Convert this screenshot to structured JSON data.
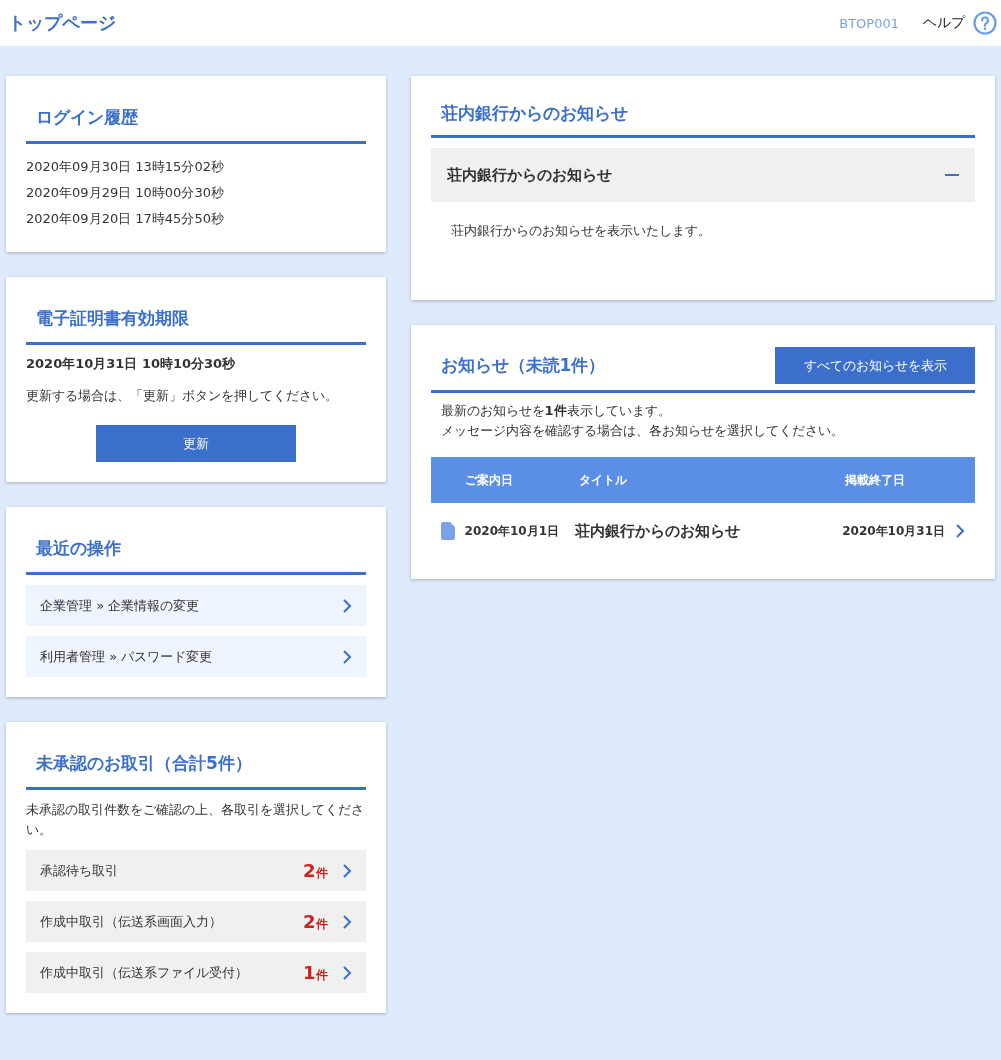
{
  "header": {
    "title": "トップページ",
    "screen_id": "BTOP001",
    "help": "ヘルプ"
  },
  "login_history": {
    "title": "ログイン履歴",
    "entries": [
      "2020年09月30日 13時15分02秒",
      "2020年09月29日 10時00分30秒",
      "2020年09月20日 17時45分50秒"
    ]
  },
  "certificate": {
    "title": "電子証明書有効期限",
    "expiry": "2020年10月31日 10時10分30秒",
    "note": "更新する場合は、「更新」ボタンを押してください。",
    "button": "更新"
  },
  "recent": {
    "title": "最近の操作",
    "items": [
      "企業管理 » 企業情報の変更",
      "利用者管理 » パスワード変更"
    ]
  },
  "pending": {
    "title": "未承認のお取引（合計5件）",
    "note": "未承認の取引件数をご確認の上、各取引を選択してください。",
    "items": [
      {
        "label": "承認待ち取引",
        "count": "2",
        "unit": "件"
      },
      {
        "label": "作成中取引（伝送系画面入力）",
        "count": "2",
        "unit": "件"
      },
      {
        "label": "作成中取引（伝送系ファイル受付）",
        "count": "1",
        "unit": "件"
      }
    ]
  },
  "bank_notice": {
    "title": "荘内銀行からのお知らせ",
    "accordion": {
      "title": "荘内銀行からのお知らせ",
      "expanded": true,
      "body": "荘内銀行からのお知らせを表示いたします。"
    }
  },
  "notices": {
    "title": "お知らせ（未読1件）",
    "button": "すべてのお知らせを表示",
    "lines": [
      "最新のお知らせを**1件**表示しています。",
      "メッセージ内容を確認する場合は、各お知らせを選択してください。"
    ],
    "columns": [
      "ご案内日",
      "タイトル",
      "掲載終了日"
    ],
    "rows": [
      {
        "date": "2020年10月1日",
        "title": "荘内銀行からのお知らせ",
        "end": "2020年10月31日"
      }
    ]
  }
}
